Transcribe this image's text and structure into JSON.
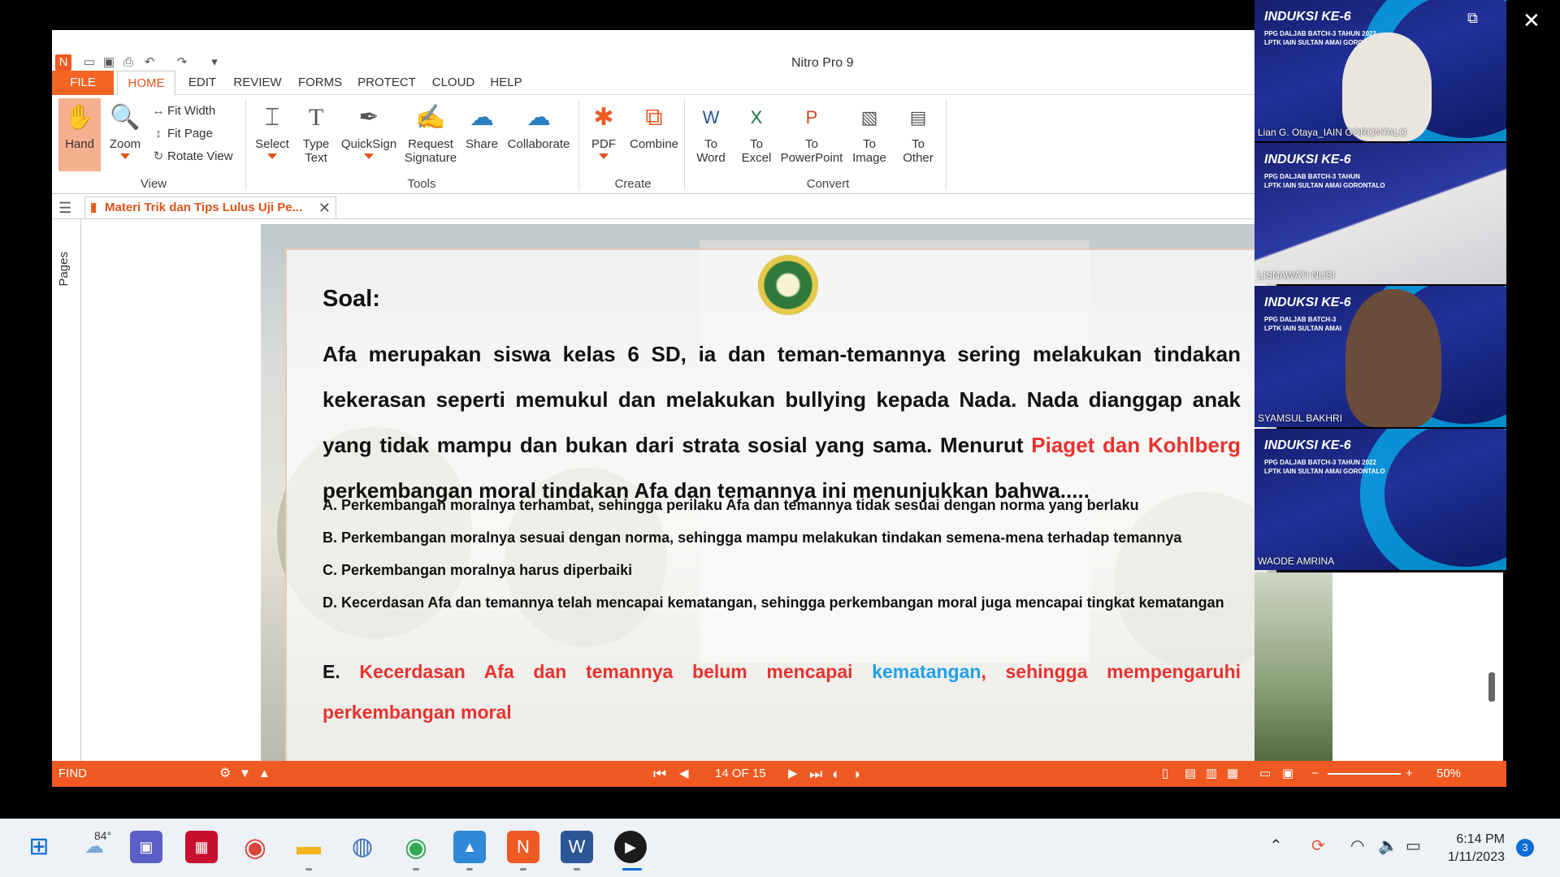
{
  "window": {
    "title": "Nitro Pro 9"
  },
  "menu": [
    "FILE",
    "HOME",
    "EDIT",
    "REVIEW",
    "FORMS",
    "PROTECT",
    "CLOUD",
    "HELP"
  ],
  "ribbon": {
    "view": {
      "hand": "Hand",
      "zoom": "Zoom",
      "fit_width": "Fit Width",
      "fit_page": "Fit Page",
      "rotate_view": "Rotate View",
      "group": "View"
    },
    "tools": {
      "select": "Select",
      "type_text_1": "Type",
      "type_text_2": "Text",
      "quicksign": "QuickSign",
      "request_sig_1": "Request",
      "request_sig_2": "Signature",
      "share": "Share",
      "collaborate": "Collaborate",
      "group": "Tools"
    },
    "create": {
      "pdf": "PDF",
      "combine": "Combine",
      "group": "Create"
    },
    "convert": {
      "to": "To",
      "word": "Word",
      "excel": "Excel",
      "powerpoint": "PowerPoint",
      "image": "Image",
      "other": "Other",
      "group": "Convert"
    }
  },
  "doc_tab": {
    "title": "Materi Trik dan Tips Lulus Uji Pe..."
  },
  "sidepane": {
    "label": "Pages"
  },
  "slide": {
    "heading": "Soal:",
    "question_a": "Afa merupakan siswa kelas 6 SD, ia dan teman-temannya sering melakukan tindakan kekerasan seperti memukul dan melakukan bullying kepada Nada. Nada dianggap anak yang tidak mampu dan bukan dari strata sosial yang sama. Menurut ",
    "question_red": "Piaget dan Kohlberg",
    "question_b": " perkembangan moral tindakan Afa dan temannya ini menunjukkan bahwa.....",
    "options": {
      "a": "A. Perkembangan moralnya terhambat, sehingga perilaku Afa dan temannya tidak sesuai dengan norma yang berlaku",
      "b": "B. Perkembangan moralnya sesuai dengan norma, sehingga mampu melakukan tindakan semena-mena terhadap temannya",
      "c": "C. Perkembangan moralnya harus diperbaiki",
      "d": "D. Kecerdasan Afa dan temannya telah mencapai kematangan, sehingga perkembangan moral juga mencapai tingkat kematangan",
      "e_prefix": "E. ",
      "e_red1": "Kecerdasan Afa dan temannya belum mencapai ",
      "e_blue": "kematangan",
      "e_red2": ", sehingga mempengaruhi perkembangan moral"
    }
  },
  "statusbar": {
    "find": "FIND",
    "page": "14 OF 15",
    "zoom": "50%"
  },
  "participants": [
    {
      "name": "Lian G. Otaya_IAIN GORONTALO",
      "banner": "INDUKSI KE-6",
      "sub": "PPG DALJAB BATCH-3 TAHUN 2022\nLPTK IAIN SULTAN AMAI GORONTALO"
    },
    {
      "name": "LISNAWATI NUSI",
      "banner": "INDUKSI KE-6",
      "sub": "PPG DALJAB BATCH-3 TAHUN\nLPTK IAIN SULTAN AMAI GORONTALO"
    },
    {
      "name": "SYAMSUL BAKHRI",
      "banner": "INDUKSI KE-6",
      "sub": "PPG DALJAB BATCH-3\nLPTK IAIN SULTAN AMAI"
    },
    {
      "name": "WAODE AMRINA",
      "banner": "INDUKSI KE-6",
      "sub": "PPG DALJAB BATCH-3 TAHUN 2022\nLPTK IAIN SULTAN AMAI GORONTALO"
    }
  ],
  "taskbar": {
    "weather": "84°",
    "time": "6:14 PM",
    "date": "1/11/2023",
    "badge": "3"
  },
  "colors": {
    "nitro_orange": "#f05a22",
    "answer_red": "#e8322f",
    "answer_blue": "#1fa1e8"
  }
}
